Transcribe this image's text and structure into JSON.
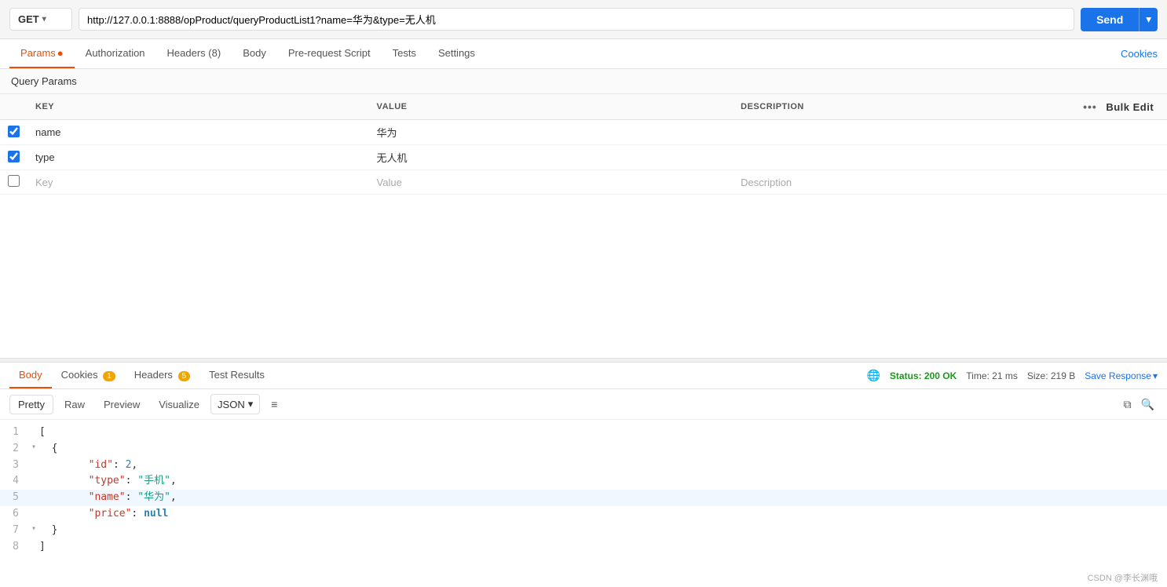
{
  "urlBar": {
    "method": "GET",
    "url": "http://127.0.0.1:8888/opProduct/queryProductList1?name=华为&type=无人机",
    "sendLabel": "Send"
  },
  "reqTabs": {
    "tabs": [
      {
        "label": "Params",
        "badge": "•",
        "active": true
      },
      {
        "label": "Authorization",
        "active": false
      },
      {
        "label": "Headers (8)",
        "active": false
      },
      {
        "label": "Body",
        "active": false
      },
      {
        "label": "Pre-request Script",
        "active": false
      },
      {
        "label": "Tests",
        "active": false
      },
      {
        "label": "Settings",
        "active": false
      }
    ],
    "cookiesLabel": "Cookies"
  },
  "queryParams": {
    "sectionTitle": "Query Params",
    "columns": {
      "key": "KEY",
      "value": "VALUE",
      "description": "DESCRIPTION",
      "bulkEdit": "Bulk Edit"
    },
    "rows": [
      {
        "checked": true,
        "key": "name",
        "value": "华为",
        "description": ""
      },
      {
        "checked": true,
        "key": "type",
        "value": "无人机",
        "description": ""
      }
    ],
    "placeholderRow": {
      "key": "Key",
      "value": "Value",
      "description": "Description"
    }
  },
  "responseTabs": {
    "tabs": [
      {
        "label": "Body",
        "active": true
      },
      {
        "label": "Cookies",
        "badge": "1"
      },
      {
        "label": "Headers",
        "badge": "5"
      },
      {
        "label": "Test Results"
      }
    ],
    "status": {
      "icon": "globe",
      "statusText": "Status: 200 OK",
      "time": "Time: 21 ms",
      "size": "Size: 219 B",
      "saveResponse": "Save Response"
    }
  },
  "formatBar": {
    "tabs": [
      "Pretty",
      "Raw",
      "Preview",
      "Visualize"
    ],
    "activeTab": "Pretty",
    "format": "JSON",
    "wrapIcon": "≡"
  },
  "codeLines": [
    {
      "num": 1,
      "content": "[",
      "type": "bracket"
    },
    {
      "num": 2,
      "content": "  {",
      "type": "bracket",
      "fold": true
    },
    {
      "num": 3,
      "content": "    \"id\": 2,",
      "type": "mixed"
    },
    {
      "num": 4,
      "content": "    \"type\": \"手机\",",
      "type": "mixed"
    },
    {
      "num": 5,
      "content": "    \"name\": \"华为\",",
      "type": "mixed",
      "active": true
    },
    {
      "num": 6,
      "content": "    \"price\": null",
      "type": "mixed"
    },
    {
      "num": 7,
      "content": "  }",
      "type": "bracket",
      "fold": true
    },
    {
      "num": 8,
      "content": "]",
      "type": "bracket"
    }
  ],
  "watermark": "CSDN @李长渊哦"
}
